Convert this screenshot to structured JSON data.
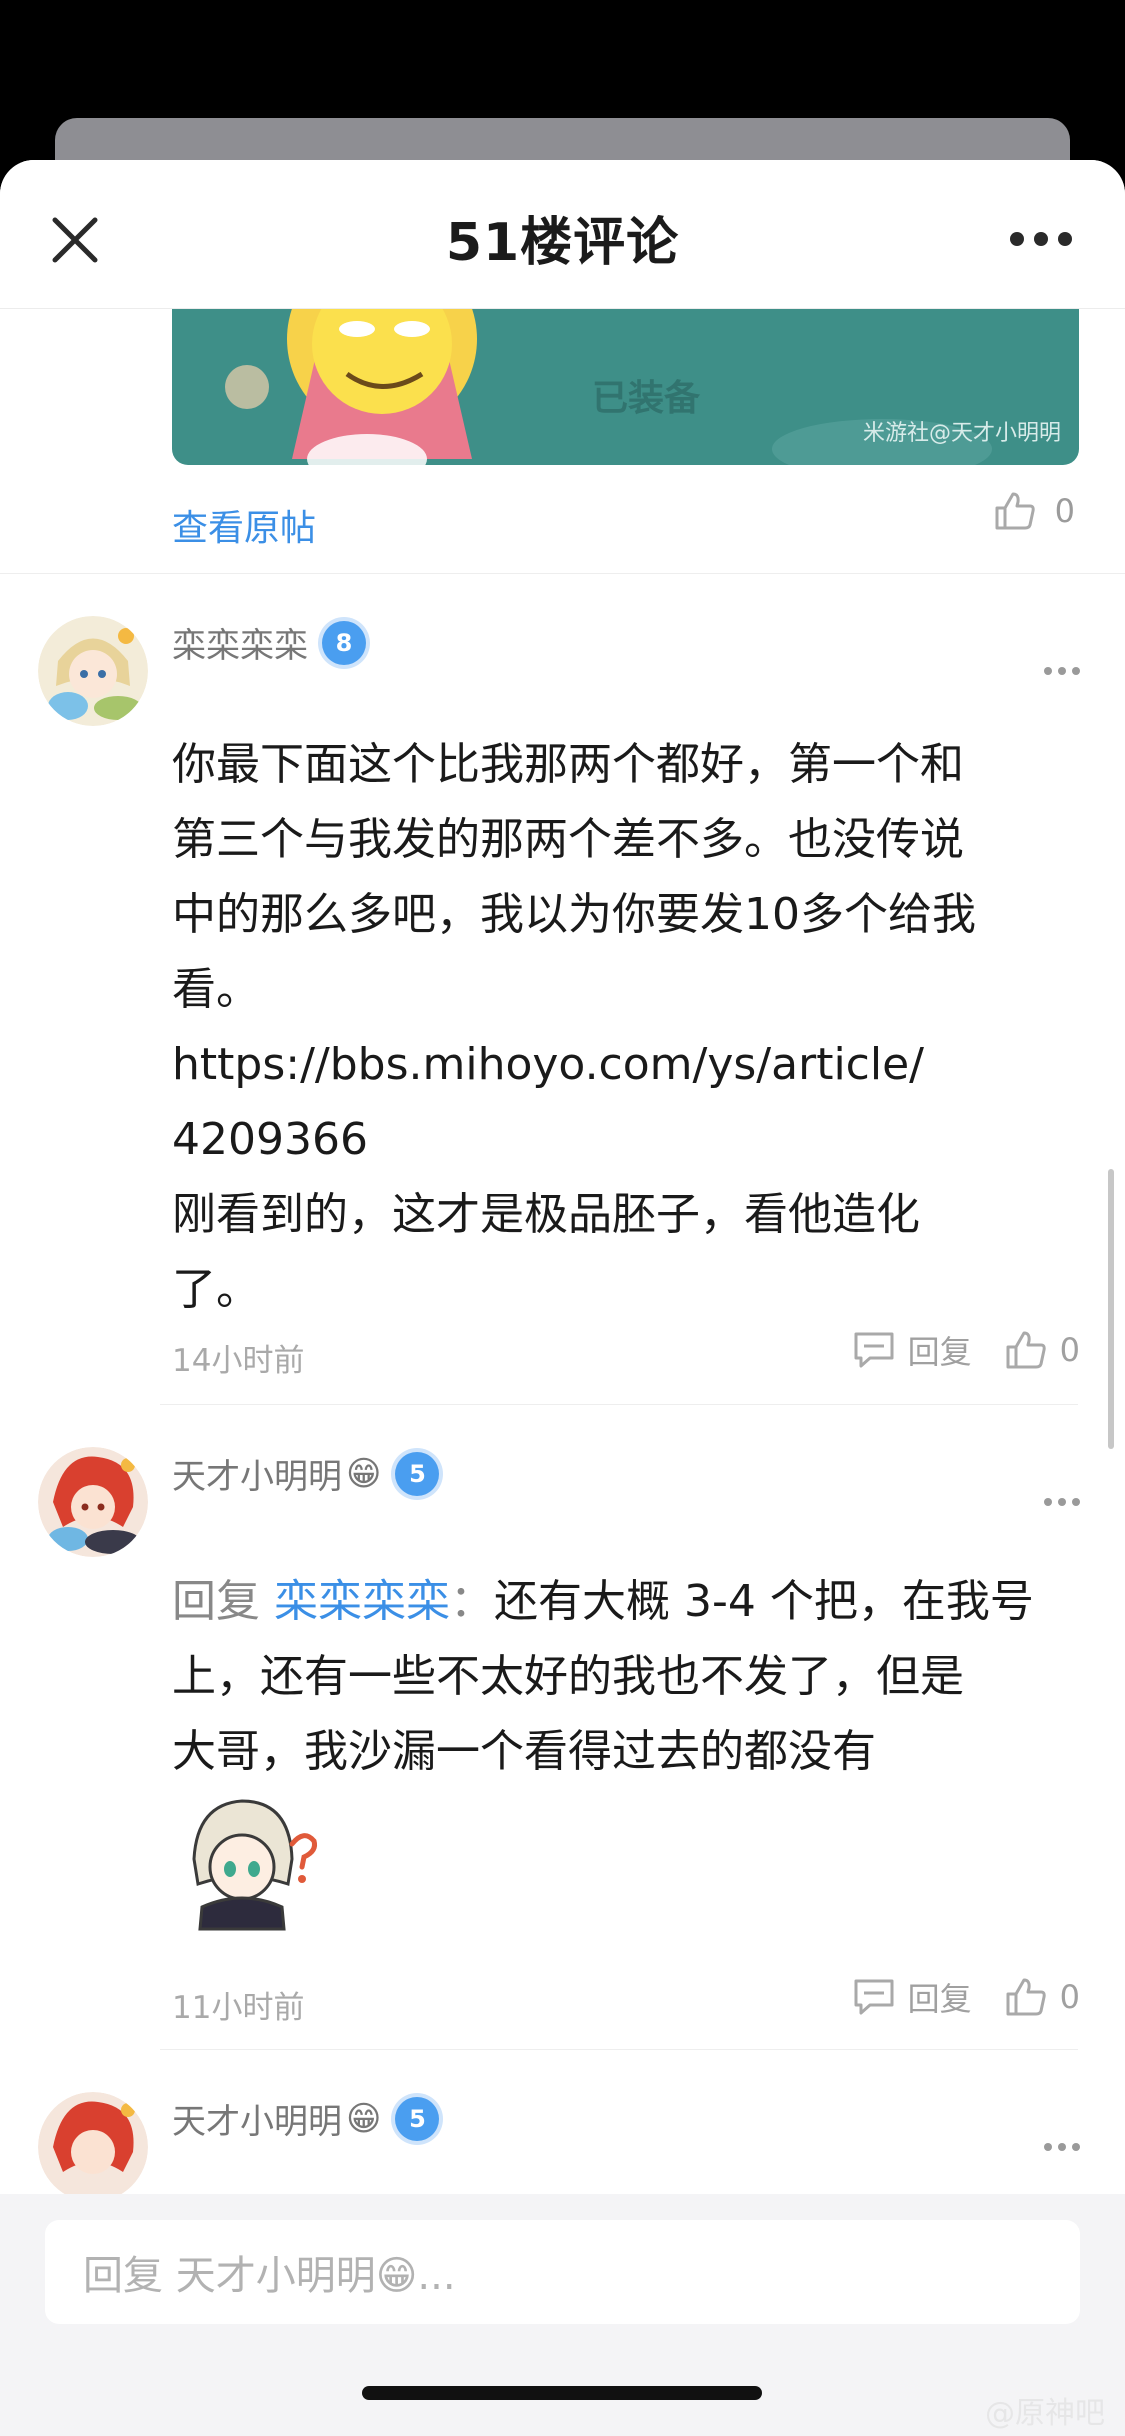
{
  "header": {
    "title": "51楼评论"
  },
  "image_card": {
    "watermark": "米游社@天才小明明",
    "deco_text": "已装备"
  },
  "prev_post": {
    "view_original": "查看原帖",
    "like_count": "0"
  },
  "comments": [
    {
      "username": "栾栾栾栾",
      "badge": "8",
      "lines": [
        "你最下面这个比我那两个都好，第一个和",
        "第三个与我发的那两个差不多。也没传说",
        "中的那么多吧，我以为你要发10多个给我",
        "看。",
        "https://bbs.mihoyo.com/ys/article/",
        "4209366",
        "刚看到的，这才是极品胚子，看他造化",
        "了。"
      ],
      "time": "14小时前",
      "reply_label": "回复",
      "like_count": "0"
    },
    {
      "username": "天才小明明",
      "emoji": "😁",
      "badge": "5",
      "reply_prefix": "回复",
      "reply_to": "栾栾栾栾",
      "reply_colon": "：",
      "line1_rest": "还有大概 3-4 个把，在我号",
      "lines": [
        "上，还有一些不太好的我也不发了，但是",
        "大哥，我沙漏一个看得过去的都没有"
      ],
      "time": "11小时前",
      "reply_label": "回复",
      "like_count": "0"
    },
    {
      "username": "天才小明明",
      "emoji": "😁",
      "badge": "5"
    }
  ],
  "bottom": {
    "input_placeholder": "回复 天才小明明😁..."
  },
  "corner_watermark": "@原神吧",
  "colors": {
    "accent": "#3b8fe6",
    "badge": "#4a9ef0",
    "card": "#3e8f88"
  }
}
